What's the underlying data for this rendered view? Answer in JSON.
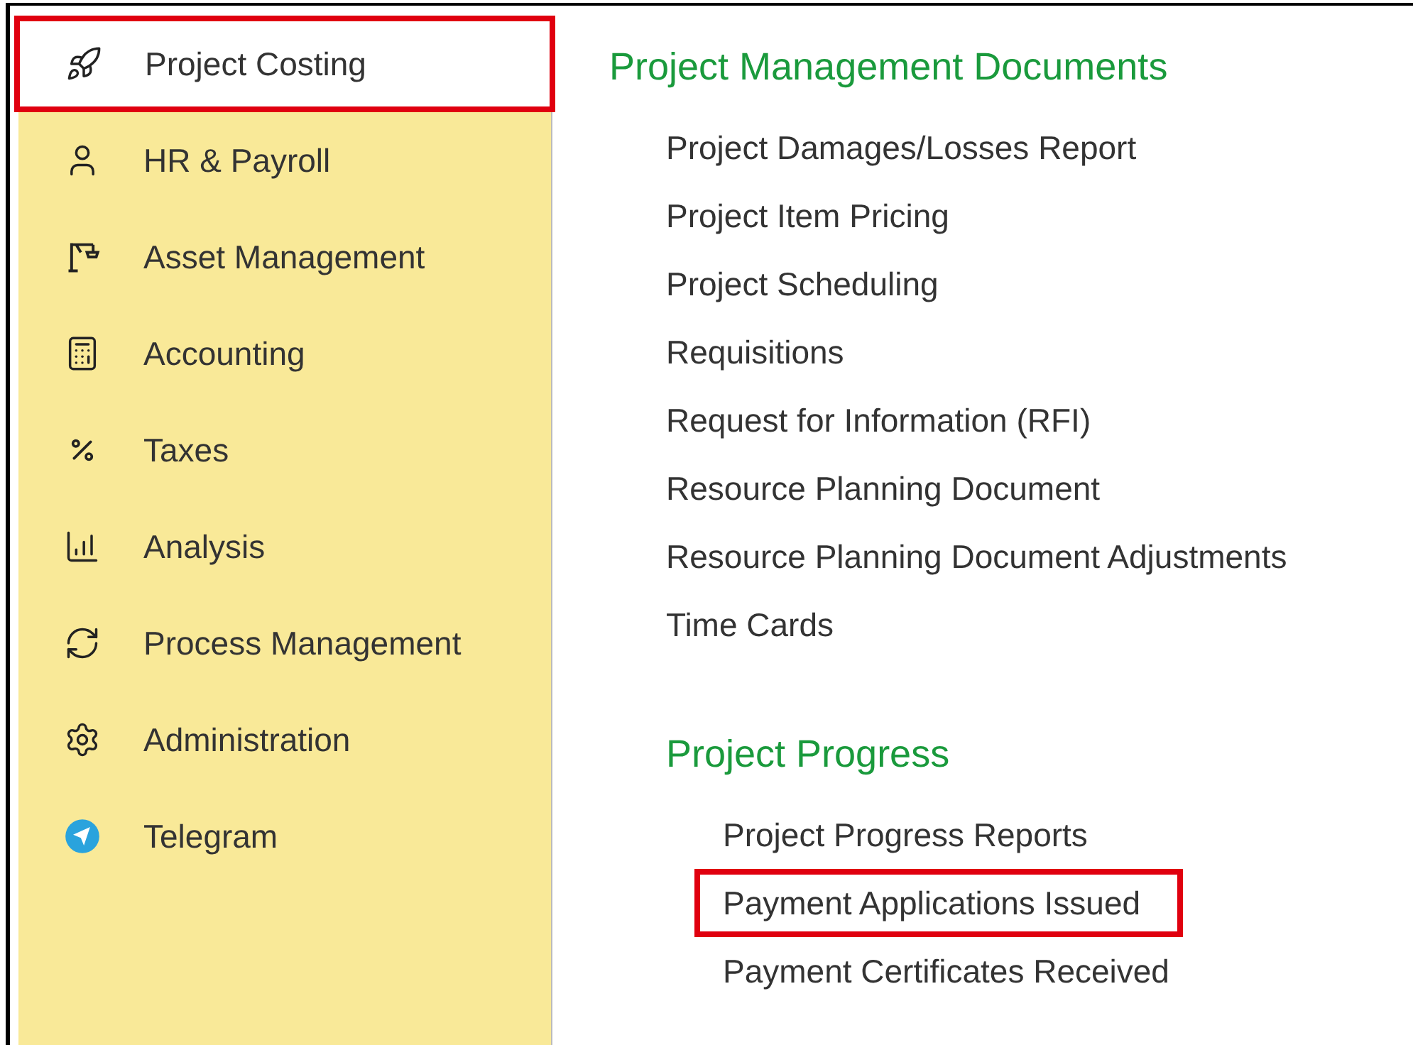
{
  "sidebar": {
    "items": [
      {
        "label": "Project Costing",
        "selected": true,
        "highlighted": true
      },
      {
        "label": "HR & Payroll",
        "selected": false,
        "highlighted": false
      },
      {
        "label": "Asset Management",
        "selected": false,
        "highlighted": false
      },
      {
        "label": "Accounting",
        "selected": false,
        "highlighted": false
      },
      {
        "label": "Taxes",
        "selected": false,
        "highlighted": false
      },
      {
        "label": "Analysis",
        "selected": false,
        "highlighted": false
      },
      {
        "label": "Process Management",
        "selected": false,
        "highlighted": false
      },
      {
        "label": "Administration",
        "selected": false,
        "highlighted": false
      },
      {
        "label": "Telegram",
        "selected": false,
        "highlighted": false
      }
    ]
  },
  "sections": [
    {
      "title": "Project Management Documents",
      "links": [
        {
          "label": "Project Damages/Losses Report",
          "highlighted": false
        },
        {
          "label": "Project Item Pricing",
          "highlighted": false
        },
        {
          "label": "Project Scheduling",
          "highlighted": false
        },
        {
          "label": "Requisitions",
          "highlighted": false
        },
        {
          "label": "Request for Information (RFI)",
          "highlighted": false
        },
        {
          "label": "Resource Planning Document",
          "highlighted": false
        },
        {
          "label": "Resource Planning Document Adjustments",
          "highlighted": false
        },
        {
          "label": "Time Cards",
          "highlighted": false
        }
      ]
    },
    {
      "title": "Project Progress",
      "links": [
        {
          "label": "Project Progress Reports",
          "highlighted": false
        },
        {
          "label": "Payment Applications Issued",
          "highlighted": true
        },
        {
          "label": "Payment Certificates Received",
          "highlighted": false
        }
      ]
    }
  ]
}
